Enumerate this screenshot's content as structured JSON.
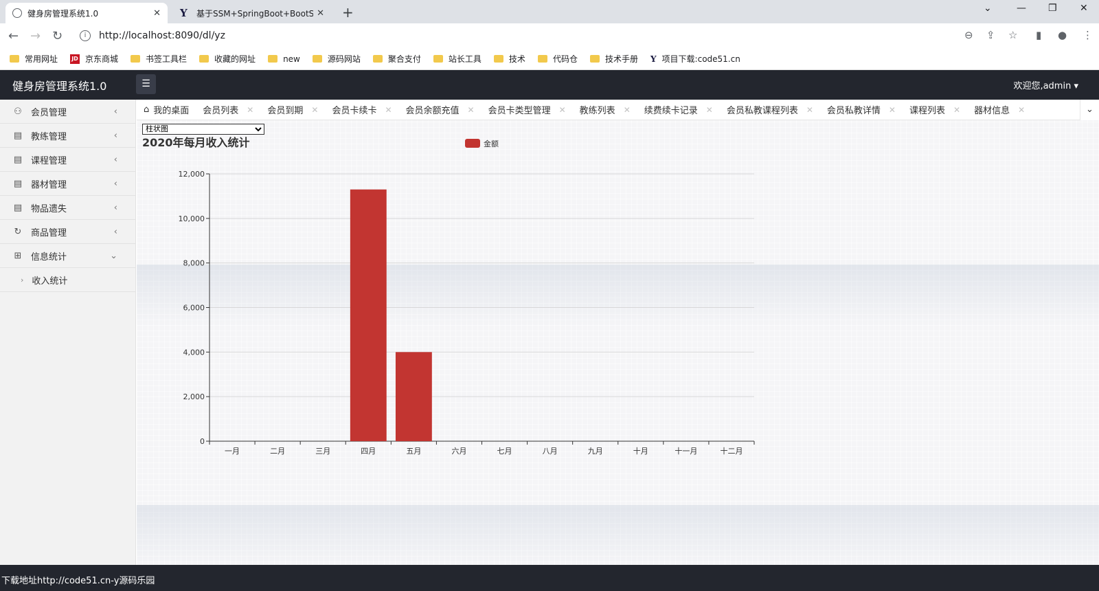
{
  "browser": {
    "tabs": [
      {
        "title": "健身房管理系统1.0",
        "active": true
      },
      {
        "title": "基于SSM+SpringBoot+BootSt",
        "active": false
      }
    ],
    "url": "http://localhost:8090/dl/yz",
    "bookmarks": [
      {
        "label": "常用网址",
        "icon": "folder-icon"
      },
      {
        "label": "京东商城",
        "icon": "jd-icon"
      },
      {
        "label": "书签工具栏",
        "icon": "folder-icon"
      },
      {
        "label": "收藏的网址",
        "icon": "folder-icon"
      },
      {
        "label": "new",
        "icon": "folder-icon"
      },
      {
        "label": "源码网站",
        "icon": "folder-icon"
      },
      {
        "label": "聚合支付",
        "icon": "folder-icon"
      },
      {
        "label": "站长工具",
        "icon": "folder-icon"
      },
      {
        "label": "技术",
        "icon": "folder-icon"
      },
      {
        "label": "代码仓",
        "icon": "folder-icon"
      },
      {
        "label": "技术手册",
        "icon": "folder-icon"
      },
      {
        "label": "项目下载:code51.cn",
        "icon": "y-icon"
      }
    ]
  },
  "app": {
    "title": "健身房管理系统1.0",
    "welcome": "欢迎您,admin"
  },
  "sidebar": {
    "items": [
      {
        "label": "会员管理",
        "icon": "user-icon",
        "expanded": false
      },
      {
        "label": "教练管理",
        "icon": "list-icon",
        "expanded": false
      },
      {
        "label": "课程管理",
        "icon": "list-icon",
        "expanded": false
      },
      {
        "label": "器材管理",
        "icon": "list-icon",
        "expanded": false
      },
      {
        "label": "物品遗失",
        "icon": "list-icon",
        "expanded": false
      },
      {
        "label": "商品管理",
        "icon": "refresh-icon",
        "expanded": false
      },
      {
        "label": "信息统计",
        "icon": "grid-icon",
        "expanded": true
      }
    ],
    "subitems": [
      {
        "label": "收入统计"
      }
    ]
  },
  "pagetabs": [
    {
      "label": "我的桌面",
      "closable": false,
      "icon": "home-icon"
    },
    {
      "label": "会员列表",
      "closable": true
    },
    {
      "label": "会员到期",
      "closable": true
    },
    {
      "label": "会员卡续卡",
      "closable": true
    },
    {
      "label": "会员余额充值",
      "closable": true
    },
    {
      "label": "会员卡类型管理",
      "closable": true
    },
    {
      "label": "教练列表",
      "closable": true
    },
    {
      "label": "续费续卡记录",
      "closable": true
    },
    {
      "label": "会员私教课程列表",
      "closable": true
    },
    {
      "label": "会员私教详情",
      "closable": true
    },
    {
      "label": "课程列表",
      "closable": true
    },
    {
      "label": "器材信息",
      "closable": true
    }
  ],
  "chart_type_select": {
    "selected": "柱状图"
  },
  "chart_data": {
    "type": "bar",
    "title": "2020年每月收入统计",
    "legend": [
      "金额"
    ],
    "legend_position": "top-center",
    "categories": [
      "一月",
      "二月",
      "三月",
      "四月",
      "五月",
      "六月",
      "七月",
      "八月",
      "九月",
      "十月",
      "十一月",
      "十二月"
    ],
    "series": [
      {
        "name": "金额",
        "values": [
          0,
          0,
          0,
          11300,
          4000,
          0,
          0,
          0,
          0,
          0,
          0,
          0
        ],
        "color": "#c23531"
      }
    ],
    "ylim": [
      0,
      12000
    ],
    "yticks": [
      "0",
      "2,000",
      "4,000",
      "6,000",
      "8,000",
      "10,000",
      "12,000"
    ],
    "grid": true
  },
  "footer": {
    "text": "下载地址http://code51.cn-y源码乐园"
  }
}
